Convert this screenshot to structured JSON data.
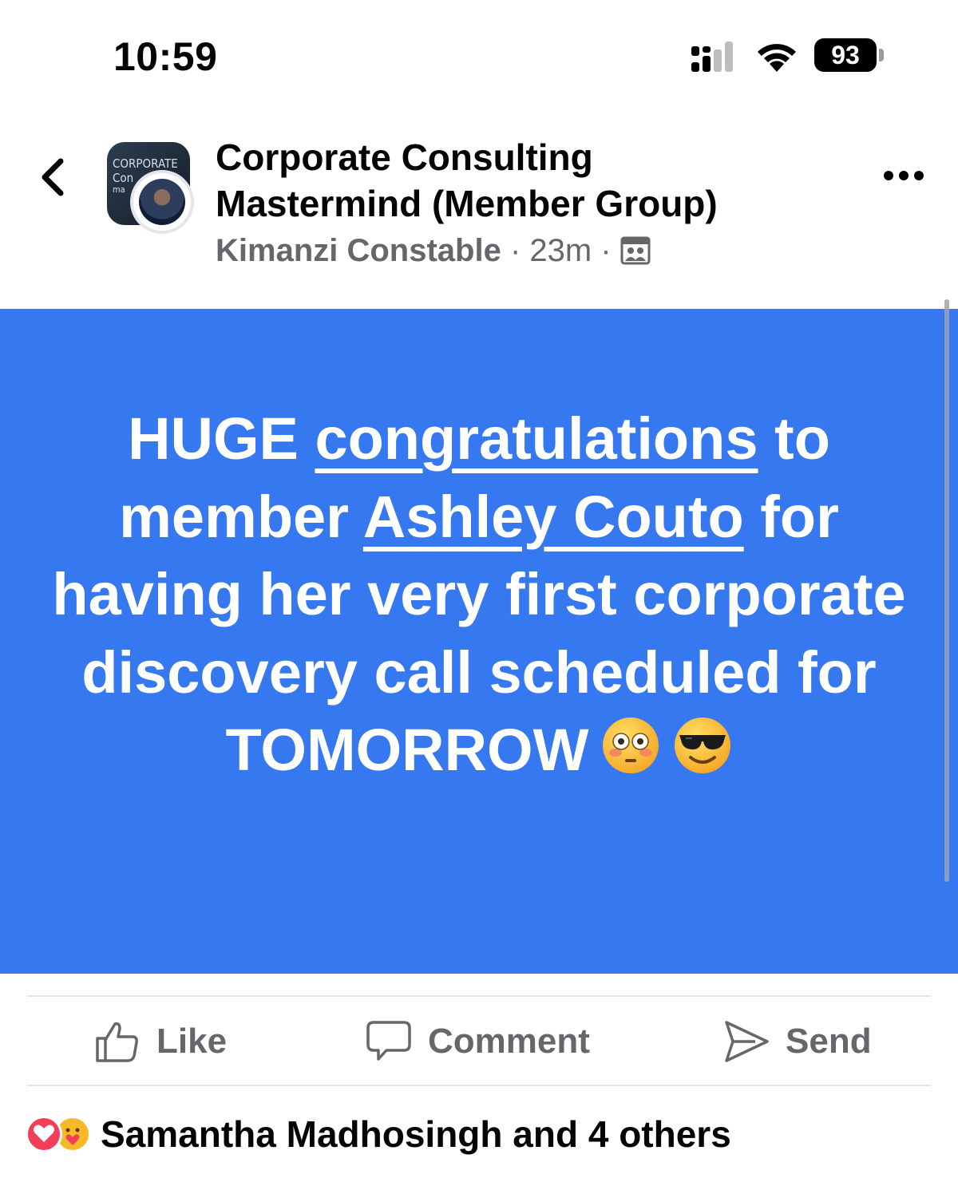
{
  "status_bar": {
    "time": "10:59",
    "battery": "93"
  },
  "header": {
    "title_line1": "Corporate Consulting",
    "title_line2": "Mastermind (Member Group)",
    "avatar_text_line1": "CORPORATE",
    "avatar_text_line2": "Con",
    "avatar_text_line3": "ma",
    "author": "Kimanzi Constable",
    "separator1": " · ",
    "time_ago": "23m",
    "separator2": " · ",
    "audience_icon": "members-group-icon"
  },
  "post": {
    "background_color": "#3578f0",
    "text_part1": "HUGE ",
    "link1": "congratulations",
    "text_part2": " to member ",
    "link2": "Ashley Couto",
    "text_part3": " for having her very first corporate discovery call scheduled for TOMORROW",
    "emoji1": "flushed-face-emoji",
    "emoji2": "smiling-face-with-sunglasses-emoji"
  },
  "actions": {
    "like_label": "Like",
    "comment_label": "Comment",
    "send_label": "Send"
  },
  "reactions": {
    "icons": [
      "love-reaction-icon",
      "care-reaction-icon"
    ],
    "summary": "Samantha Madhosingh and 4 others"
  }
}
